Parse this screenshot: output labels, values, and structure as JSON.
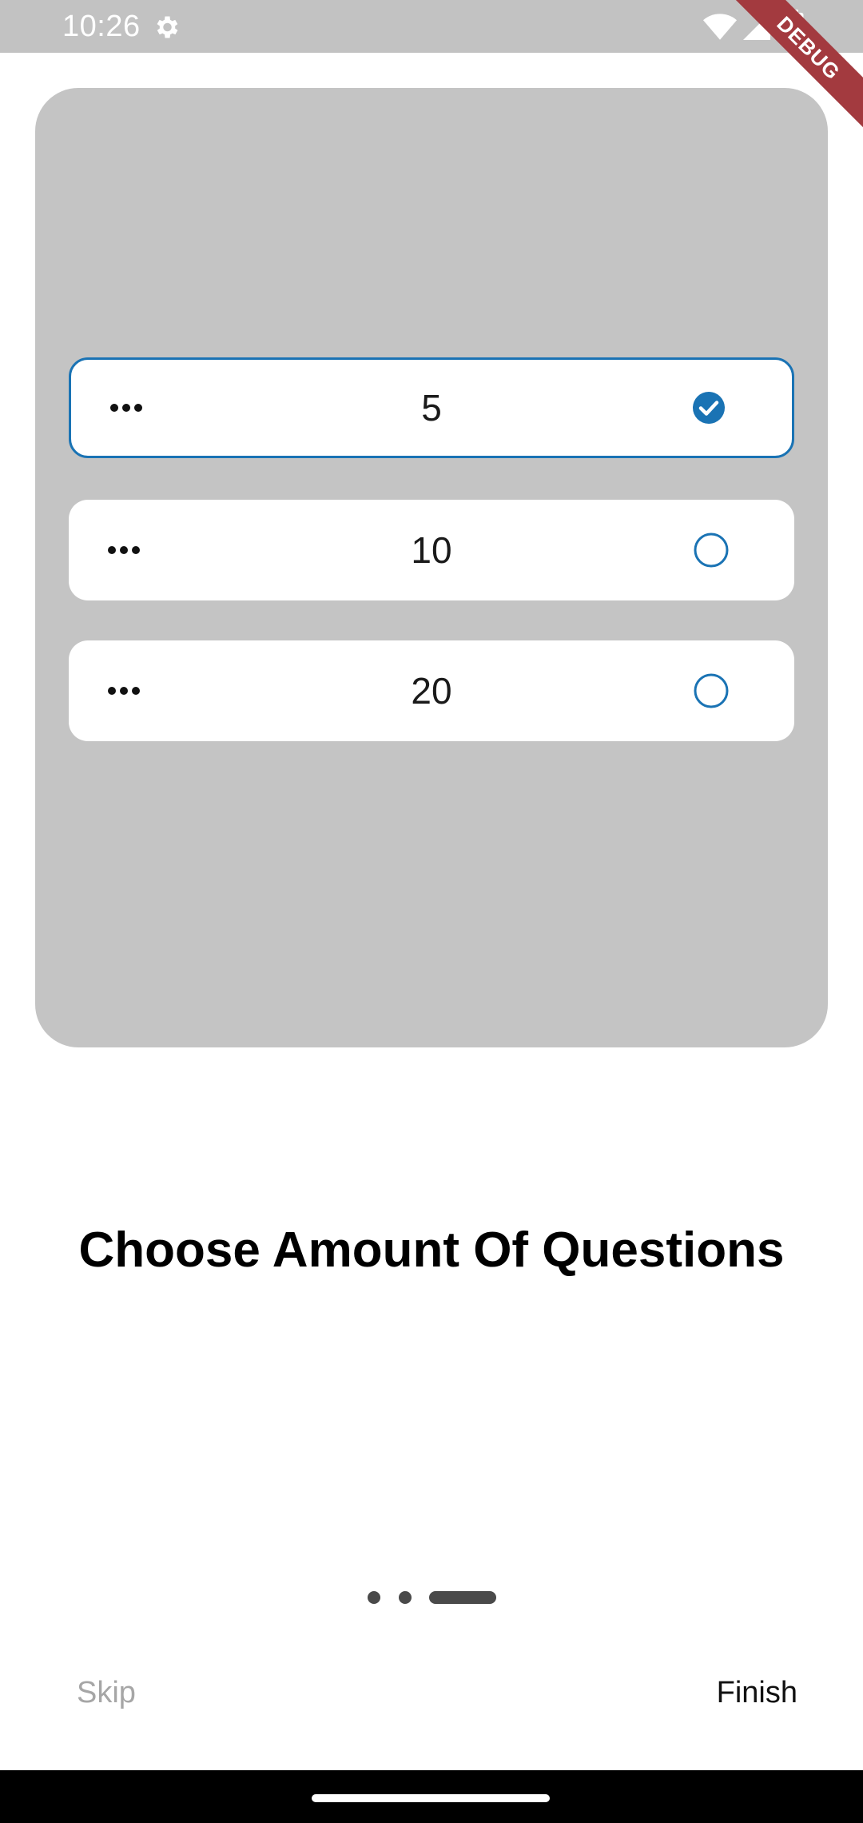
{
  "status_bar": {
    "time": "10:26",
    "icons": [
      "gear-icon",
      "wifi-icon",
      "signal-icon",
      "battery-icon"
    ]
  },
  "debug_banner": "DEBUG",
  "options": [
    {
      "value": "5",
      "selected": true
    },
    {
      "value": "10",
      "selected": false
    },
    {
      "value": "20",
      "selected": false
    }
  ],
  "title": "Choose Amount Of Questions",
  "page_indicator": {
    "count": 3,
    "active": 3
  },
  "buttons": {
    "skip": "Skip",
    "finish": "Finish"
  },
  "colors": {
    "accent": "#1a73b4",
    "card_bg": "#c4c4c4",
    "status_bar_bg": "#c2c2c2",
    "debug_ribbon": "#a33a3f"
  }
}
